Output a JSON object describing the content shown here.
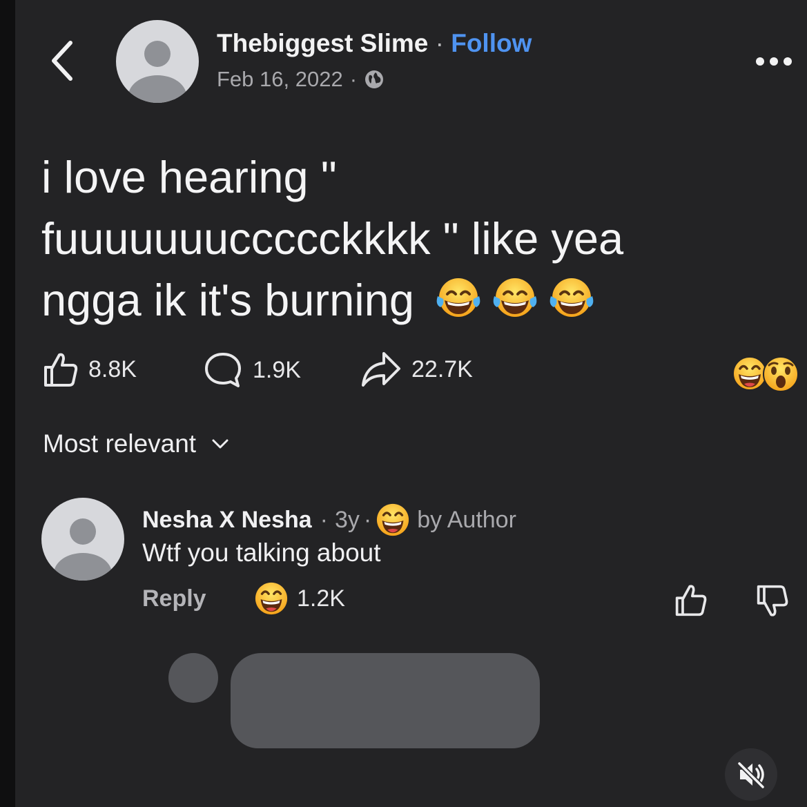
{
  "post": {
    "author": "Thebiggest Slime",
    "separator": "·",
    "follow_label": "Follow",
    "date": "Feb 16, 2022",
    "date_separator": "·",
    "privacy_icon": "globe-icon",
    "text": "i love hearing \" fuuuuuuuccccckkkk \" like yea ngga ik it's burning",
    "text_emojis": [
      "tears-of-joy-emoji",
      "tears-of-joy-emoji",
      "tears-of-joy-emoji"
    ]
  },
  "stats": {
    "likes": "8.8K",
    "comments": "1.9K",
    "shares": "22.7K",
    "reaction_icons": [
      "grinning-squint-emoji",
      "astonished-emoji"
    ]
  },
  "sort": {
    "label": "Most relevant"
  },
  "comment": {
    "author": "Nesha X Nesha",
    "sep1": "·",
    "age": "3y",
    "sep2": "·",
    "author_reaction": "grinning-squint-emoji",
    "by_author": "by Author",
    "text": "Wtf you talking about",
    "reply_label": "Reply",
    "reaction_icon": "grinning-squint-emoji",
    "reaction_count": "1.2K"
  },
  "colors": {
    "background": "#232325",
    "follow": "#4f93f0",
    "muted_text": "#a9a9ad",
    "placeholder": "#55565a"
  }
}
